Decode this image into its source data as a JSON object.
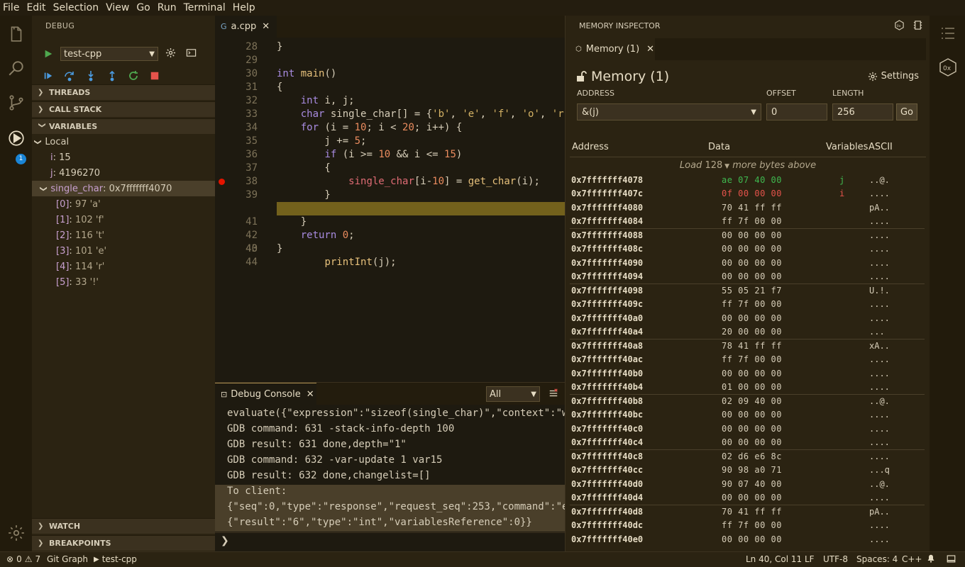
{
  "menu": [
    "File",
    "Edit",
    "Selection",
    "View",
    "Go",
    "Run",
    "Terminal",
    "Help"
  ],
  "activity": {
    "debug_badge": "1"
  },
  "sidebar": {
    "title": "DEBUG",
    "config": "test-cpp",
    "sections": {
      "threads": "THREADS",
      "callstack": "CALL STACK",
      "variables": "VARIABLES",
      "watch": "WATCH",
      "breakpoints": "BREAKPOINTS"
    },
    "local_label": "Local",
    "vars": [
      {
        "name": "i",
        "value": "15"
      },
      {
        "name": "j",
        "value": "4196270"
      }
    ],
    "array": {
      "name": "single_char",
      "value": "0x7fffffff4070"
    },
    "elements": [
      {
        "name": "[0]",
        "value": "97 'a'"
      },
      {
        "name": "[1]",
        "value": "102 'f'"
      },
      {
        "name": "[2]",
        "value": "116 't'"
      },
      {
        "name": "[3]",
        "value": "101 'e'"
      },
      {
        "name": "[4]",
        "value": "114 'r'"
      },
      {
        "name": "[5]",
        "value": "33 '!'"
      }
    ]
  },
  "editor": {
    "tab": "a.cpp",
    "lines": [
      "28",
      "29",
      "30",
      "31",
      "32",
      "33",
      "34",
      "35",
      "36",
      "37",
      "38",
      "39",
      "40",
      "41",
      "42",
      "43",
      "44"
    ]
  },
  "console": {
    "tab": "Debug Console",
    "filter": "All",
    "lines": [
      "evaluate({\"expression\":\"sizeof(single_char)\",\"context\":\"w",
      "GDB command: 631 -stack-info-depth 100",
      "GDB result: 631 done,depth=\"1\"",
      "GDB command: 632 -var-update 1 var15",
      "GDB result: 632 done,changelist=[]",
      "To client:",
      "{\"seq\":0,\"type\":\"response\",\"request_seq\":253,\"command\":\"e",
      "{\"result\":\"6\",\"type\":\"int\",\"variablesReference\":0}}"
    ],
    "prompt": "❯"
  },
  "memory": {
    "panel_title": "MEMORY INSPECTOR",
    "tab": "Memory (1)",
    "heading": "Memory (1)",
    "settings": "Settings",
    "address_label": "ADDRESS",
    "offset_label": "OFFSET",
    "length_label": "LENGTH",
    "address": "&(j)",
    "offset": "0",
    "length": "256",
    "go": "Go",
    "columns": {
      "address": "Address",
      "data": "Data",
      "variables": "Variables",
      "ascii": "ASCII"
    },
    "load": {
      "prefix": "Load",
      "count": "128",
      "suffix": "more bytes above"
    },
    "rows": [
      {
        "addr": "0x7fffffff4078",
        "data": "ae 07 40 00",
        "var": "j",
        "ascii": "..@."
      },
      {
        "addr": "0x7fffffff407c",
        "data": "0f 00 00 00",
        "var": "i",
        "ascii": "...."
      },
      {
        "addr": "0x7fffffff4080",
        "data": "70 41 ff ff",
        "var": "",
        "ascii": "pA.."
      },
      {
        "addr": "0x7fffffff4084",
        "data": "ff 7f 00 00",
        "var": "",
        "ascii": "...."
      },
      {
        "addr": "0x7fffffff4088",
        "data": "00 00 00 00",
        "var": "",
        "ascii": "...."
      },
      {
        "addr": "0x7fffffff408c",
        "data": "00 00 00 00",
        "var": "",
        "ascii": "...."
      },
      {
        "addr": "0x7fffffff4090",
        "data": "00 00 00 00",
        "var": "",
        "ascii": "...."
      },
      {
        "addr": "0x7fffffff4094",
        "data": "00 00 00 00",
        "var": "",
        "ascii": "...."
      },
      {
        "addr": "0x7fffffff4098",
        "data": "55 05 21 f7",
        "var": "",
        "ascii": "U.!."
      },
      {
        "addr": "0x7fffffff409c",
        "data": "ff 7f 00 00",
        "var": "",
        "ascii": "...."
      },
      {
        "addr": "0x7fffffff40a0",
        "data": "00 00 00 00",
        "var": "",
        "ascii": "...."
      },
      {
        "addr": "0x7fffffff40a4",
        "data": "20 00 00 00",
        "var": "",
        "ascii": " ..."
      },
      {
        "addr": "0x7fffffff40a8",
        "data": "78 41 ff ff",
        "var": "",
        "ascii": "xA.."
      },
      {
        "addr": "0x7fffffff40ac",
        "data": "ff 7f 00 00",
        "var": "",
        "ascii": "...."
      },
      {
        "addr": "0x7fffffff40b0",
        "data": "00 00 00 00",
        "var": "",
        "ascii": "...."
      },
      {
        "addr": "0x7fffffff40b4",
        "data": "01 00 00 00",
        "var": "",
        "ascii": "...."
      },
      {
        "addr": "0x7fffffff40b8",
        "data": "02 09 40 00",
        "var": "",
        "ascii": "..@."
      },
      {
        "addr": "0x7fffffff40bc",
        "data": "00 00 00 00",
        "var": "",
        "ascii": "...."
      },
      {
        "addr": "0x7fffffff40c0",
        "data": "00 00 00 00",
        "var": "",
        "ascii": "...."
      },
      {
        "addr": "0x7fffffff40c4",
        "data": "00 00 00 00",
        "var": "",
        "ascii": "...."
      },
      {
        "addr": "0x7fffffff40c8",
        "data": "02 d6 e6 8c",
        "var": "",
        "ascii": "...."
      },
      {
        "addr": "0x7fffffff40cc",
        "data": "90 98 a0 71",
        "var": "",
        "ascii": "...q"
      },
      {
        "addr": "0x7fffffff40d0",
        "data": "90 07 40 00",
        "var": "",
        "ascii": "..@."
      },
      {
        "addr": "0x7fffffff40d4",
        "data": "00 00 00 00",
        "var": "",
        "ascii": "...."
      },
      {
        "addr": "0x7fffffff40d8",
        "data": "70 41 ff ff",
        "var": "",
        "ascii": "pA.."
      },
      {
        "addr": "0x7fffffff40dc",
        "data": "ff 7f 00 00",
        "var": "",
        "ascii": "...."
      },
      {
        "addr": "0x7fffffff40e0",
        "data": "00 00 00 00",
        "var": "",
        "ascii": "...."
      }
    ]
  },
  "status": {
    "errors": "0",
    "warnings": "7",
    "git_graph": "Git Graph",
    "debug_config": "test-cpp",
    "position": "Ln 40, Col 11",
    "eol": "LF",
    "encoding": "UTF-8",
    "spaces": "Spaces: 4",
    "language": "C++"
  },
  "colors": {
    "accent": "#73611c",
    "breakpoint": "#e51400",
    "badge": "#1a85d6"
  }
}
